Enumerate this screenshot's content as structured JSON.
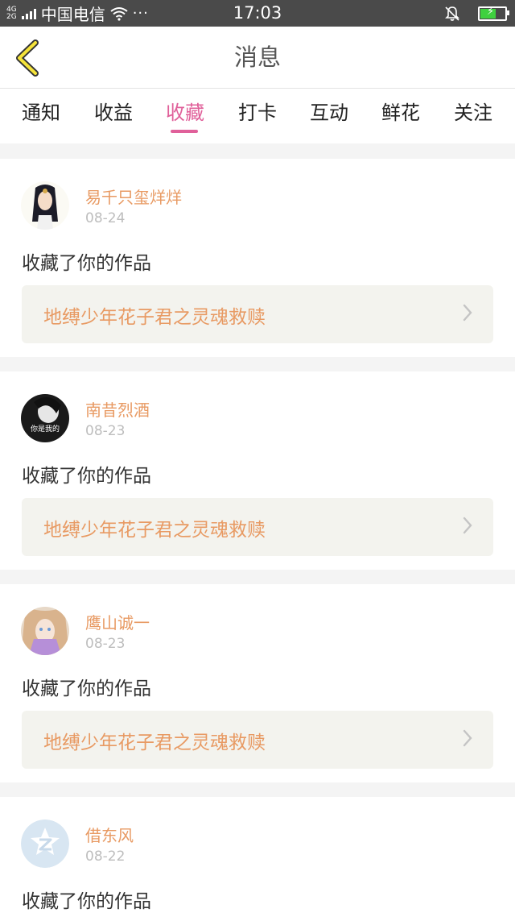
{
  "status_bar": {
    "network_top": "4G",
    "network_bottom": "2G",
    "carrier": "中国电信",
    "dots": "···",
    "time": "17:03"
  },
  "header": {
    "title": "消息"
  },
  "tabs": [
    {
      "label": "通知"
    },
    {
      "label": "收益"
    },
    {
      "label": "收藏"
    },
    {
      "label": "打卡"
    },
    {
      "label": "互动"
    },
    {
      "label": "鲜花"
    },
    {
      "label": "关注"
    }
  ],
  "active_tab": "收藏",
  "colors": {
    "accent": "#e0609a",
    "username": "#e89a63",
    "work_title": "#e89a63"
  },
  "messages": [
    {
      "username": "易千只玺烊烊",
      "date": "08-24",
      "action": "收藏了你的作品",
      "work_title": "地缚少年花子君之灵魂救赎"
    },
    {
      "username": "南昔烈酒",
      "date": "08-23",
      "action": "收藏了你的作品",
      "work_title": "地缚少年花子君之灵魂救赎",
      "avatar_text": "你是我的"
    },
    {
      "username": "鹰山诚一",
      "date": "08-23",
      "action": "收藏了你的作品",
      "work_title": "地缚少年花子君之灵魂救赎"
    },
    {
      "username": "借东风",
      "date": "08-22",
      "action": "收藏了你的作品"
    }
  ]
}
